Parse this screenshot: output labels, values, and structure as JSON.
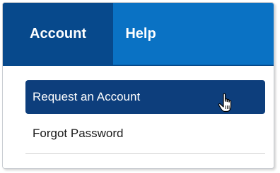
{
  "menubar": {
    "tabs": [
      {
        "label": "Account",
        "active": true
      },
      {
        "label": "Help",
        "active": false
      }
    ]
  },
  "dropdown": {
    "items": [
      {
        "label": "Request an Account",
        "highlighted": true
      },
      {
        "label": "Forgot Password",
        "highlighted": false
      }
    ]
  },
  "colors": {
    "menubar_bg": "#0a72c4",
    "active_tab_bg": "#07498c",
    "highlight_bg": "#0d3e7c"
  },
  "icons": {
    "cursor": "hand-pointer-icon"
  }
}
